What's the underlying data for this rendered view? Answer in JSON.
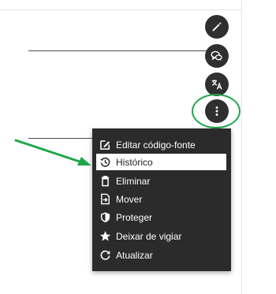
{
  "toolbar": {
    "edit_icon": "pencil-icon",
    "talk_icon": "speech-bubbles-icon",
    "language_icon": "translate-icon",
    "more_icon": "vertical-ellipsis-icon"
  },
  "menu": {
    "items": [
      {
        "label": "Editar código-fonte",
        "icon": "edit-source-icon"
      },
      {
        "label": "Histórico",
        "icon": "history-icon",
        "selected": true
      },
      {
        "label": "Eliminar",
        "icon": "trash-icon"
      },
      {
        "label": "Mover",
        "icon": "move-icon"
      },
      {
        "label": "Proteger",
        "icon": "shield-icon"
      },
      {
        "label": "Deixar de vigiar",
        "icon": "star-icon"
      },
      {
        "label": "Atualizar",
        "icon": "refresh-icon"
      }
    ]
  },
  "colors": {
    "highlight": "#1fa64a",
    "menu_background": "#2b2b2b",
    "button_background": "#2f2f2f"
  }
}
